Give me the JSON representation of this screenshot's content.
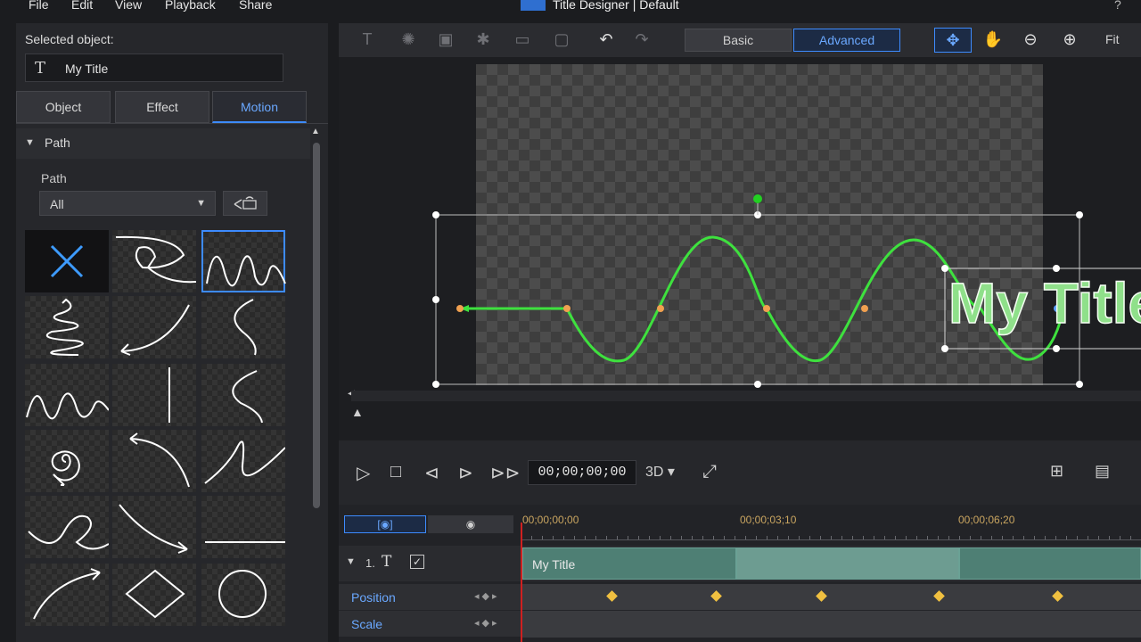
{
  "menu": {
    "items": [
      "File",
      "Edit",
      "View",
      "Playback",
      "Share"
    ]
  },
  "window": {
    "title": "Title Designer | Default",
    "help": "?"
  },
  "left_panel": {
    "selected_label": "Selected object:",
    "selected_name": "My Title",
    "tabs": [
      "Object",
      "Effect",
      "Motion"
    ],
    "active_tab": "Motion",
    "section_title": "Path",
    "path_label": "Path",
    "path_filter": "All"
  },
  "toolbar": {
    "mode_basic": "Basic",
    "mode_advanced": "Advanced",
    "fit": "Fit"
  },
  "canvas": {
    "title_text": "My Title"
  },
  "transport": {
    "timecode": "00;00;00;00",
    "mode_3d": "3D"
  },
  "timeline": {
    "ticks": [
      "00;00;00;00",
      "00;00;03;10",
      "00;00;06;20"
    ],
    "track_number": "1.",
    "clip_label": "My Title",
    "rows": [
      "Position",
      "Scale"
    ]
  },
  "colors": {
    "accent": "#3d8bff",
    "path": "#3ee13e",
    "keyframe": "#f0c040",
    "playhead": "#d02020"
  }
}
